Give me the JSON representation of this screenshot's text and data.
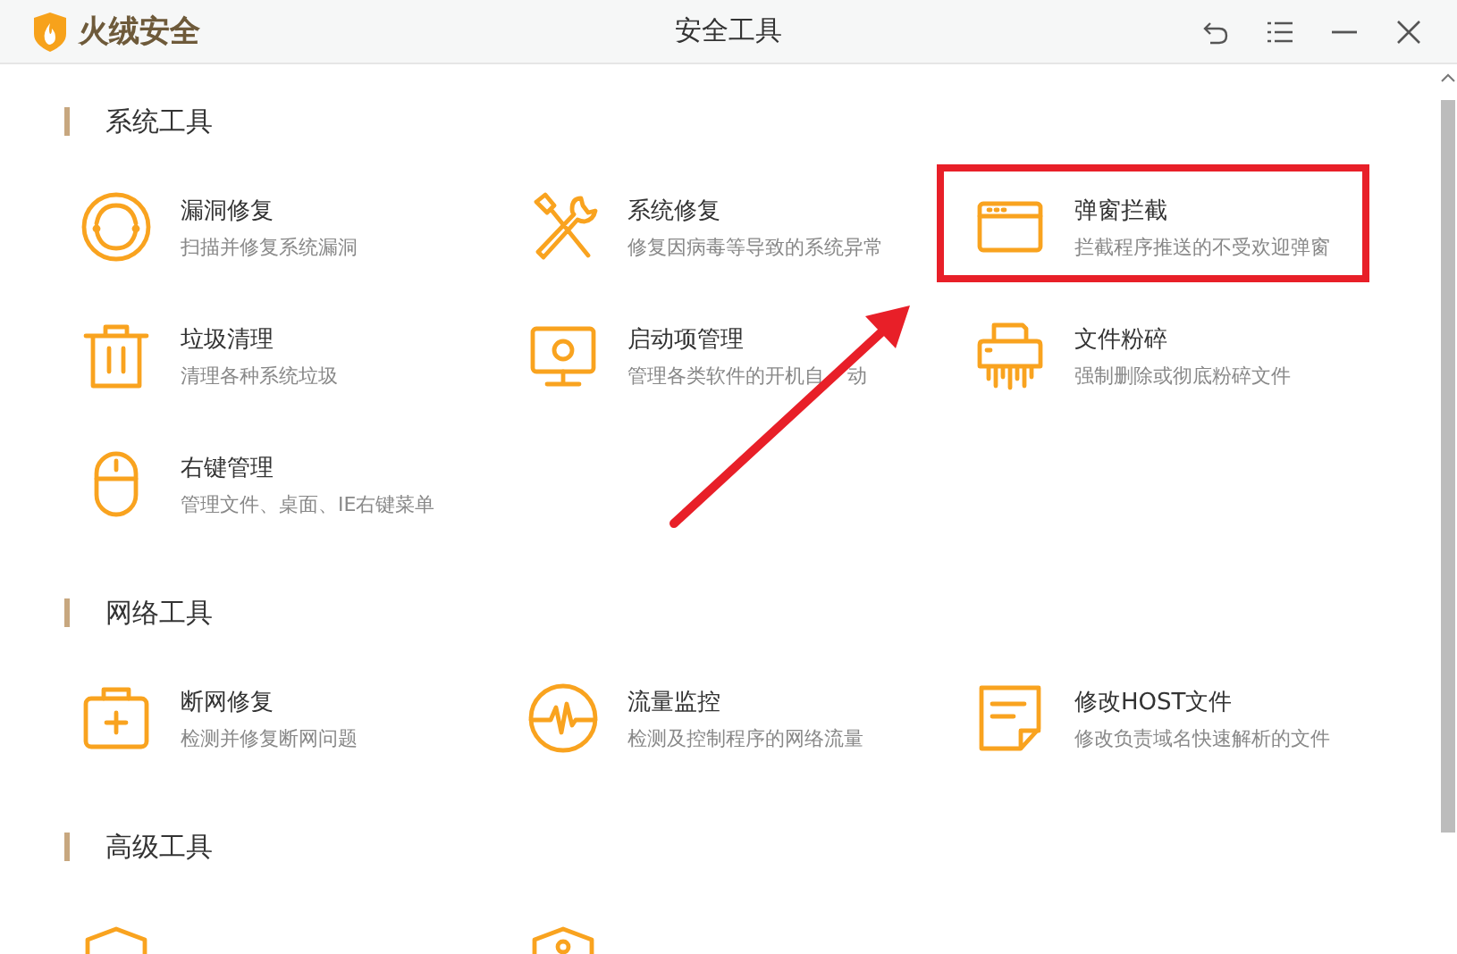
{
  "window": {
    "brand": "火绒安全",
    "title": "安全工具"
  },
  "sections": [
    {
      "title": "系统工具",
      "items": [
        {
          "title": "漏洞修复",
          "description": "扫描并修复系统漏洞"
        },
        {
          "title": "系统修复",
          "description": "修复因病毒等导致的系统异常"
        },
        {
          "title": "弹窗拦截",
          "description": "拦截程序推送的不受欢迎弹窗"
        },
        {
          "title": "垃圾清理",
          "description": "清理各种系统垃圾"
        },
        {
          "title": "启动项管理",
          "description": "管理各类软件的开机自",
          "description_tail": "动"
        },
        {
          "title": "文件粉碎",
          "description": "强制删除或彻底粉碎文件"
        },
        {
          "title": "右键管理",
          "description": "管理文件、桌面、IE右键菜单"
        }
      ]
    },
    {
      "title": "网络工具",
      "items": [
        {
          "title": "断网修复",
          "description": "检测并修复断网问题"
        },
        {
          "title": "流量监控",
          "description": "检测及控制程序的网络流量"
        },
        {
          "title": "修改HOST文件",
          "description": "修改负责域名快速解析的文件"
        }
      ]
    },
    {
      "title": "高级工具",
      "items": [
        {
          "kind": "clipped"
        },
        {
          "kind": "clipped"
        }
      ]
    }
  ]
}
